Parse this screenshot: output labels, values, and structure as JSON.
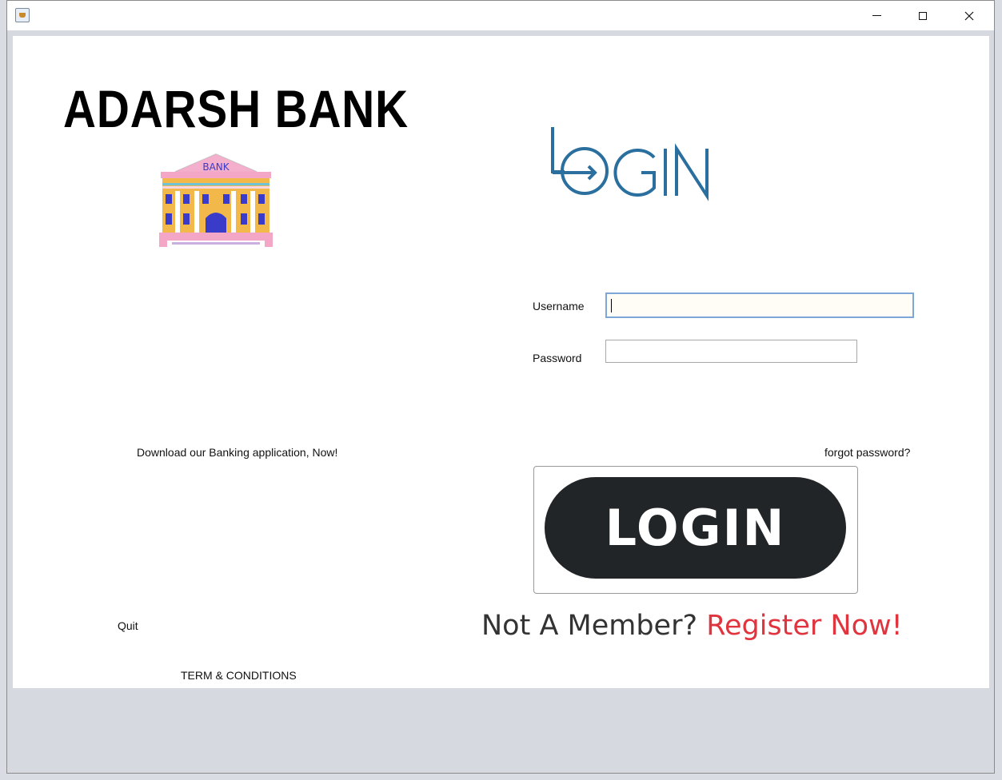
{
  "window": {
    "icon": "java-cup-icon",
    "controls": {
      "minimize": "minimize-icon",
      "maximize": "maximize-icon",
      "close": "close-icon"
    }
  },
  "brand": {
    "title": "ADARSH BANK",
    "logo_text": "BANK"
  },
  "login_logo": {
    "text": "LOGIN"
  },
  "form": {
    "username_label": "Username",
    "username_value": "",
    "password_label": "Password",
    "password_value": "",
    "forgot_link": "forgot password?",
    "login_button": "LOGIN"
  },
  "register": {
    "prefix": "Not A Member?",
    "action": "Register Now!"
  },
  "left_links": {
    "download": "Download our Banking application, Now!",
    "quit": "Quit",
    "terms": "TERM & CONDITIONS"
  },
  "colors": {
    "accent_blue": "#2a6f9e",
    "button_dark": "#212527",
    "register_red": "#e0343e",
    "field_focus": "#7ea6d6"
  }
}
